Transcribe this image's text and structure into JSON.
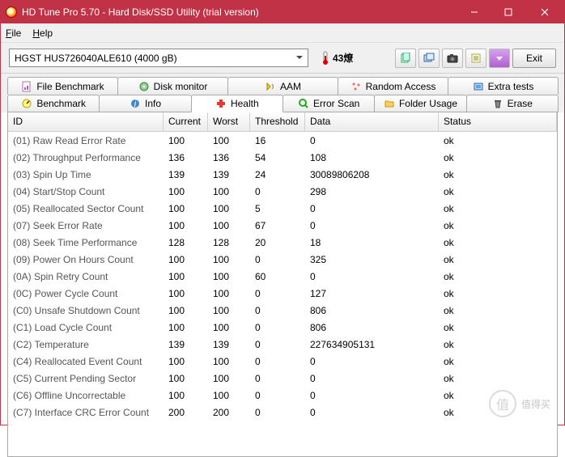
{
  "window": {
    "title": "HD Tune Pro 5.70 - Hard Disk/SSD Utility (trial version)"
  },
  "menu": {
    "file": "File",
    "help": "Help"
  },
  "toolbar": {
    "drive": "HGST HUS726040ALE610 (4000 gB)",
    "temperature": "43燎",
    "exit": "Exit"
  },
  "tabs_row1": [
    {
      "label": "File Benchmark"
    },
    {
      "label": "Disk monitor"
    },
    {
      "label": "AAM"
    },
    {
      "label": "Random Access"
    },
    {
      "label": "Extra tests"
    }
  ],
  "tabs_row2": [
    {
      "label": "Benchmark"
    },
    {
      "label": "Info"
    },
    {
      "label": "Health",
      "selected": true
    },
    {
      "label": "Error Scan"
    },
    {
      "label": "Folder Usage"
    },
    {
      "label": "Erase"
    }
  ],
  "columns": {
    "id": "ID",
    "current": "Current",
    "worst": "Worst",
    "threshold": "Threshold",
    "data": "Data",
    "status": "Status"
  },
  "rows": [
    {
      "id": "(01) Raw Read Error Rate",
      "cur": "100",
      "wor": "100",
      "thr": "16",
      "dat": "0",
      "sta": "ok"
    },
    {
      "id": "(02) Throughput Performance",
      "cur": "136",
      "wor": "136",
      "thr": "54",
      "dat": "108",
      "sta": "ok"
    },
    {
      "id": "(03) Spin Up Time",
      "cur": "139",
      "wor": "139",
      "thr": "24",
      "dat": "30089806208",
      "sta": "ok"
    },
    {
      "id": "(04) Start/Stop Count",
      "cur": "100",
      "wor": "100",
      "thr": "0",
      "dat": "298",
      "sta": "ok"
    },
    {
      "id": "(05) Reallocated Sector Count",
      "cur": "100",
      "wor": "100",
      "thr": "5",
      "dat": "0",
      "sta": "ok"
    },
    {
      "id": "(07) Seek Error Rate",
      "cur": "100",
      "wor": "100",
      "thr": "67",
      "dat": "0",
      "sta": "ok"
    },
    {
      "id": "(08) Seek Time Performance",
      "cur": "128",
      "wor": "128",
      "thr": "20",
      "dat": "18",
      "sta": "ok"
    },
    {
      "id": "(09) Power On Hours Count",
      "cur": "100",
      "wor": "100",
      "thr": "0",
      "dat": "325",
      "sta": "ok"
    },
    {
      "id": "(0A) Spin Retry Count",
      "cur": "100",
      "wor": "100",
      "thr": "60",
      "dat": "0",
      "sta": "ok"
    },
    {
      "id": "(0C) Power Cycle Count",
      "cur": "100",
      "wor": "100",
      "thr": "0",
      "dat": "127",
      "sta": "ok"
    },
    {
      "id": "(C0) Unsafe Shutdown Count",
      "cur": "100",
      "wor": "100",
      "thr": "0",
      "dat": "806",
      "sta": "ok"
    },
    {
      "id": "(C1) Load Cycle Count",
      "cur": "100",
      "wor": "100",
      "thr": "0",
      "dat": "806",
      "sta": "ok"
    },
    {
      "id": "(C2) Temperature",
      "cur": "139",
      "wor": "139",
      "thr": "0",
      "dat": "227634905131",
      "sta": "ok"
    },
    {
      "id": "(C4) Reallocated Event Count",
      "cur": "100",
      "wor": "100",
      "thr": "0",
      "dat": "0",
      "sta": "ok"
    },
    {
      "id": "(C5) Current Pending Sector",
      "cur": "100",
      "wor": "100",
      "thr": "0",
      "dat": "0",
      "sta": "ok"
    },
    {
      "id": "(C6) Offline Uncorrectable",
      "cur": "100",
      "wor": "100",
      "thr": "0",
      "dat": "0",
      "sta": "ok"
    },
    {
      "id": "(C7) Interface CRC Error Count",
      "cur": "200",
      "wor": "200",
      "thr": "0",
      "dat": "0",
      "sta": "ok"
    }
  ],
  "watermark": {
    "text": "值得买"
  }
}
